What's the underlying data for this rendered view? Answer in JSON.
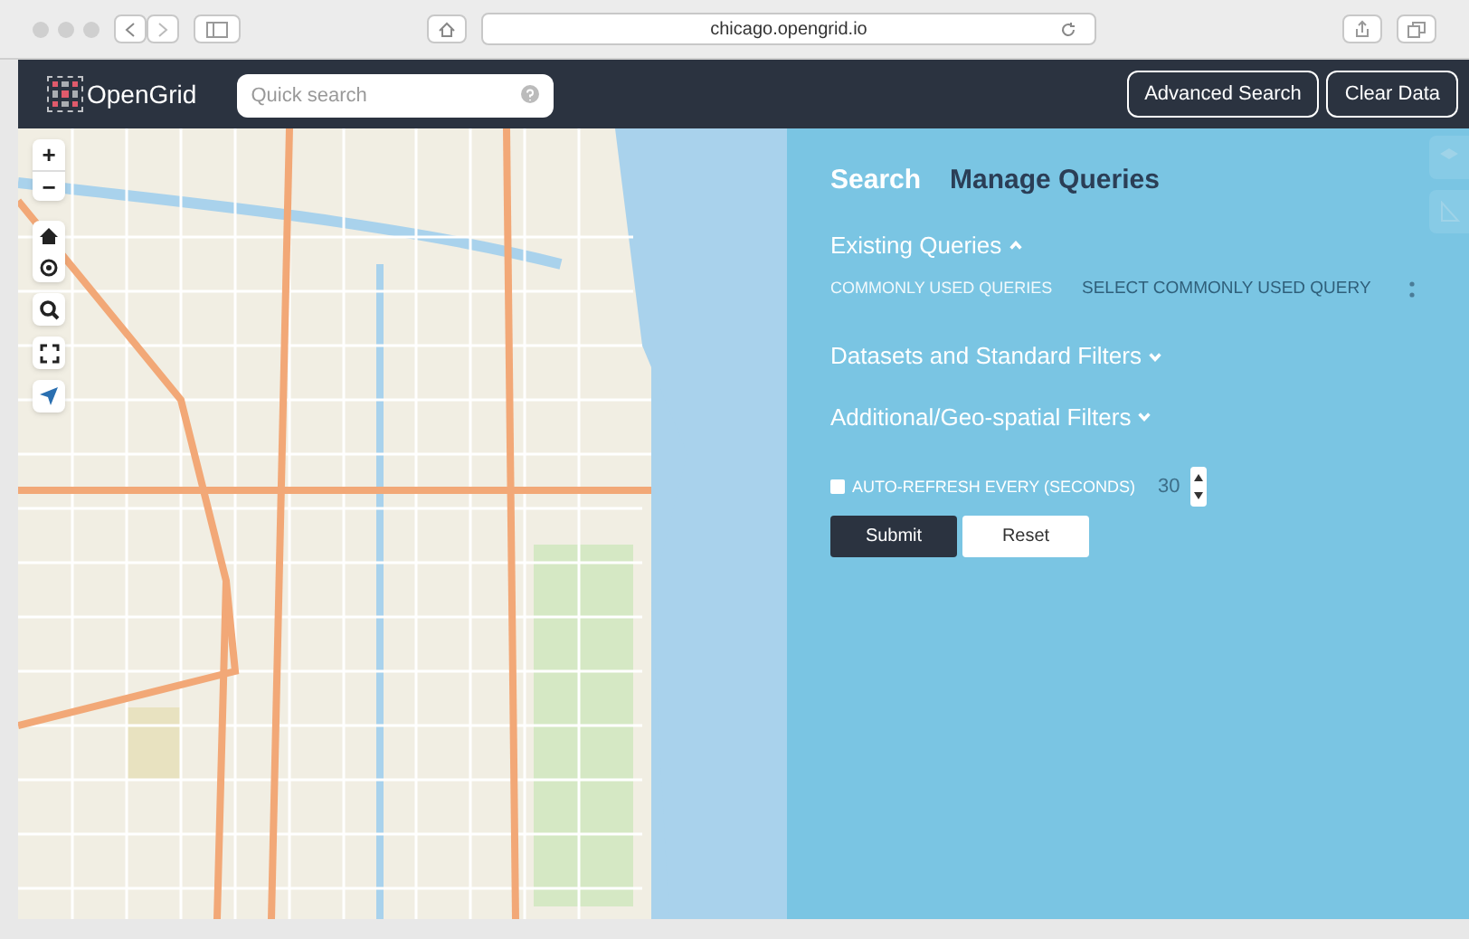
{
  "browser": {
    "url": "chicago.opengrid.io"
  },
  "header": {
    "logo": "OpenGrid",
    "search": {
      "placeholder": "Quick search"
    },
    "buttons": [
      "Advanced Search",
      "Clear Data"
    ]
  },
  "map_controls": [
    "+",
    "−"
  ],
  "panel": {
    "tabs": [
      {
        "label": "Search",
        "selected": true
      },
      {
        "label": "Manage Queries",
        "selected": false
      }
    ],
    "sections": [
      {
        "title": "Existing Queries",
        "expanded": true
      },
      {
        "title": "Datasets and Standard Filters",
        "expanded": false
      },
      {
        "title": "Additional/Geo-spatial Filters",
        "expanded": false
      }
    ],
    "common_queries": {
      "label": "COMMONLY USED QUERIES",
      "placeholder": "SELECT COMMONLY USED QUERY"
    },
    "auto_refresh": {
      "label": "AUTO-REFRESH EVERY (SECONDS)",
      "checked": false,
      "value": "30"
    },
    "buttons": [
      {
        "label": "Submit",
        "kind": "primary"
      },
      {
        "label": "Reset",
        "kind": "secondary"
      }
    ]
  }
}
